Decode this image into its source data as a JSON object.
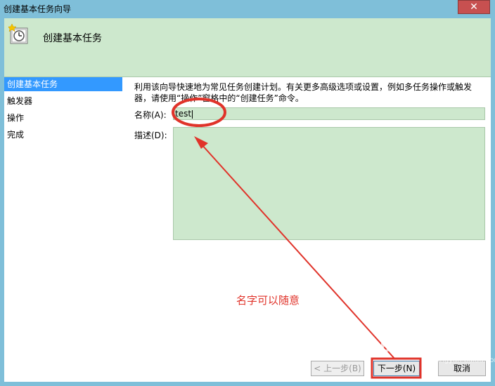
{
  "window": {
    "title": "创建基本任务向导",
    "close_glyph": "✕"
  },
  "header": {
    "title": "创建基本任务",
    "icon": "clock-icon"
  },
  "sidebar": {
    "items": [
      {
        "label": "创建基本任务",
        "active": true
      },
      {
        "label": "触发器"
      },
      {
        "label": "操作"
      },
      {
        "label": "完成"
      }
    ]
  },
  "main": {
    "intro_line1": "利用该向导快速地为常见任务创建计划。有关更多高级选项或设置，例如多任务操作或触发",
    "intro_line2": "器，请使用“操作”窗格中的“创建任务”命令。",
    "name_label": "名称(A):",
    "name_value": "test",
    "desc_label": "描述(D):",
    "desc_value": ""
  },
  "buttons": {
    "back": "< 上一步(B)",
    "next": "下一步(N)",
    "cancel": "取消"
  },
  "annotation": {
    "text": "名字可以随意",
    "color": "#e0332a"
  },
  "watermark": {
    "text": "Bai 经验",
    "sub": "jingyan.baidu.com"
  },
  "colors": {
    "accent": "#3399ff",
    "field_bg": "#cde8cd",
    "close": "#c75050"
  }
}
